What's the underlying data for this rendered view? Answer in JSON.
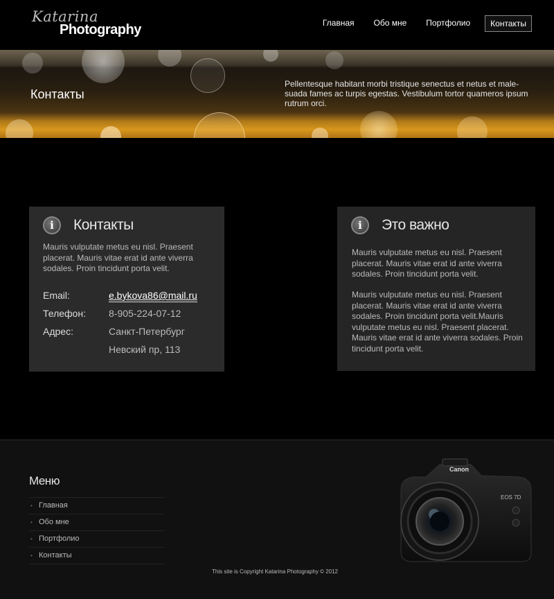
{
  "header": {
    "logo_script": "Katarina",
    "logo_brand": "Photography",
    "nav": [
      {
        "label": "Главная",
        "active": false
      },
      {
        "label": "Обо мне",
        "active": false
      },
      {
        "label": "Портфолио",
        "active": false
      },
      {
        "label": "Контакты",
        "active": true
      }
    ]
  },
  "banner": {
    "title": "Контакты",
    "lead": "Pellentesque habitant morbi tristique senectus et netus et male-suada fames ac turpis egestas. Vestibulum tortor quameros ipsum rutrum orci."
  },
  "contacts_card": {
    "icon": "info-icon",
    "title": "Контакты",
    "text": "Mauris vulputate metus eu nisl. Praesent placerat. Mauris vitae erat id ante viverra sodales. Proin tincidunt porta velit.",
    "rows": [
      {
        "label": "Email:",
        "value": "e.bykova86@mail.ru"
      },
      {
        "label": "Телефон:",
        "value": "8-905-224-07-12"
      },
      {
        "label": "Адрес:",
        "value": "Санкт-Петербург"
      },
      {
        "label": "",
        "value": "Невский пр, 113"
      }
    ]
  },
  "important_card": {
    "icon": "info-icon",
    "title": "Это важно",
    "text1": "Mauris vulputate metus eu nisl. Praesent placerat. Mauris vitae erat id ante viverra sodales. Proin tincidunt porta velit.",
    "text2": "Mauris vulputate metus eu nisl. Praesent placerat. Mauris vitae erat id ante viverra sodales. Proin tincidunt porta velit.Mauris vulputate metus eu nisl. Praesent placerat. Mauris vitae erat id ante viverra sodales. Proin tincidunt porta velit."
  },
  "footer": {
    "menu_title": "Меню",
    "menu_items": [
      "Главная",
      "Обо мне",
      "Портфолио",
      "Контакты"
    ],
    "copyright": "This site is Copyright Katarina Photography © 2012",
    "camera_brand": "Canon",
    "camera_model": "EOS 7D"
  },
  "colors": {
    "background": "#000000",
    "card": "#2b2b2b",
    "footer": "#111111",
    "banner_accent": "#d8971c"
  }
}
